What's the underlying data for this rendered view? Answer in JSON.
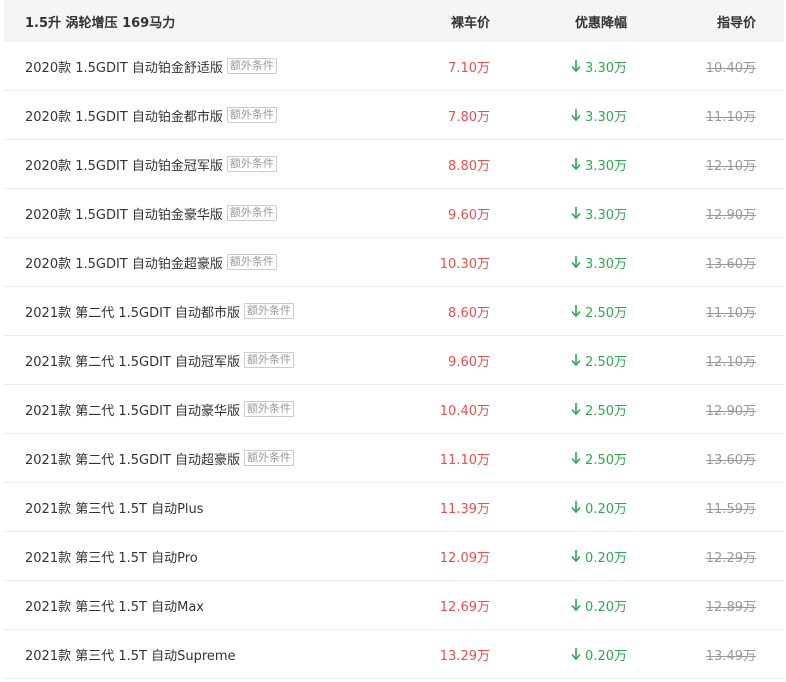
{
  "header": {
    "title": "1.5升 涡轮增压 169马力",
    "col_price": "裸车价",
    "col_discount": "优惠降幅",
    "col_guide": "指导价"
  },
  "colors": {
    "price": "#e94f4f",
    "discount": "#2fa84f",
    "guide": "#999999",
    "header_bg": "#f5f5f5"
  },
  "icons": {
    "discount_arrow": "arrow-down-icon"
  },
  "rows": [
    {
      "name": "2020款 1.5GDIT 自动铂金舒适版",
      "tag": "额外条件",
      "price": "7.10万",
      "discount": "3.30万",
      "guide": "10.40万"
    },
    {
      "name": "2020款 1.5GDIT 自动铂金都市版",
      "tag": "额外条件",
      "price": "7.80万",
      "discount": "3.30万",
      "guide": "11.10万"
    },
    {
      "name": "2020款 1.5GDIT 自动铂金冠军版",
      "tag": "额外条件",
      "price": "8.80万",
      "discount": "3.30万",
      "guide": "12.10万"
    },
    {
      "name": "2020款 1.5GDIT 自动铂金豪华版",
      "tag": "额外条件",
      "price": "9.60万",
      "discount": "3.30万",
      "guide": "12.90万"
    },
    {
      "name": "2020款 1.5GDIT 自动铂金超豪版",
      "tag": "额外条件",
      "price": "10.30万",
      "discount": "3.30万",
      "guide": "13.60万"
    },
    {
      "name": "2021款 第二代 1.5GDIT 自动都市版",
      "tag": "额外条件",
      "price": "8.60万",
      "discount": "2.50万",
      "guide": "11.10万"
    },
    {
      "name": "2021款 第二代 1.5GDIT 自动冠军版",
      "tag": "额外条件",
      "price": "9.60万",
      "discount": "2.50万",
      "guide": "12.10万"
    },
    {
      "name": "2021款 第二代 1.5GDIT 自动豪华版",
      "tag": "额外条件",
      "price": "10.40万",
      "discount": "2.50万",
      "guide": "12.90万"
    },
    {
      "name": "2021款 第二代 1.5GDIT 自动超豪版",
      "tag": "额外条件",
      "price": "11.10万",
      "discount": "2.50万",
      "guide": "13.60万"
    },
    {
      "name": "2021款 第三代 1.5T 自动Plus",
      "tag": "",
      "price": "11.39万",
      "discount": "0.20万",
      "guide": "11.59万"
    },
    {
      "name": "2021款 第三代 1.5T 自动Pro",
      "tag": "",
      "price": "12.09万",
      "discount": "0.20万",
      "guide": "12.29万"
    },
    {
      "name": "2021款 第三代 1.5T 自动Max",
      "tag": "",
      "price": "12.69万",
      "discount": "0.20万",
      "guide": "12.89万"
    },
    {
      "name": "2021款 第三代 1.5T 自动Supreme",
      "tag": "",
      "price": "13.29万",
      "discount": "0.20万",
      "guide": "13.49万"
    }
  ]
}
